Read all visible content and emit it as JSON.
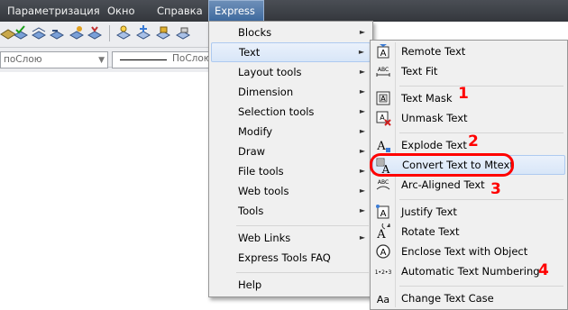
{
  "menubar": {
    "items": [
      {
        "label": "Параметризация"
      },
      {
        "label": "Окно"
      },
      {
        "label": "Справка"
      },
      {
        "label": "Express"
      }
    ]
  },
  "toolbar": {
    "layer_combo": "поСлою",
    "linetype_combo": "ПоСлою"
  },
  "express_menu": {
    "items": [
      {
        "label": "Blocks",
        "submenu": true
      },
      {
        "label": "Text",
        "submenu": true,
        "highlighted": true
      },
      {
        "label": "Layout tools",
        "submenu": true
      },
      {
        "label": "Dimension",
        "submenu": true
      },
      {
        "label": "Selection tools",
        "submenu": true
      },
      {
        "label": "Modify",
        "submenu": true
      },
      {
        "label": "Draw",
        "submenu": true
      },
      {
        "label": "File tools",
        "submenu": true
      },
      {
        "label": "Web tools",
        "submenu": true
      },
      {
        "label": "Tools",
        "submenu": true
      },
      {
        "label": "Web Links",
        "submenu": true
      },
      {
        "label": "Express Tools FAQ",
        "submenu": false
      },
      {
        "label": "Help",
        "submenu": false
      }
    ]
  },
  "text_menu": {
    "items": [
      {
        "label": "Remote Text",
        "icon": "remote-text-icon"
      },
      {
        "label": "Text Fit",
        "icon": "text-fit-icon"
      },
      {
        "label": "Text Mask",
        "icon": "text-mask-icon"
      },
      {
        "label": "Unmask Text",
        "icon": "unmask-text-icon"
      },
      {
        "label": "Explode Text",
        "icon": "explode-text-icon"
      },
      {
        "label": "Convert Text to Mtext",
        "icon": "convert-text-icon",
        "highlighted": true
      },
      {
        "label": "Arc-Aligned Text",
        "icon": "arc-aligned-text-icon"
      },
      {
        "label": "Justify Text",
        "icon": "justify-text-icon"
      },
      {
        "label": "Rotate Text",
        "icon": "rotate-text-icon"
      },
      {
        "label": "Enclose Text with Object",
        "icon": "enclose-text-icon"
      },
      {
        "label": "Automatic Text Numbering",
        "icon": "text-numbering-icon"
      },
      {
        "label": "Change Text Case",
        "icon": "change-case-icon"
      }
    ]
  },
  "annotations": [
    "1",
    "2",
    "3",
    "4"
  ],
  "colors": {
    "annotation": "#ff0000",
    "highlight": "#d8e6f8",
    "menubar": "#3a3d42"
  }
}
